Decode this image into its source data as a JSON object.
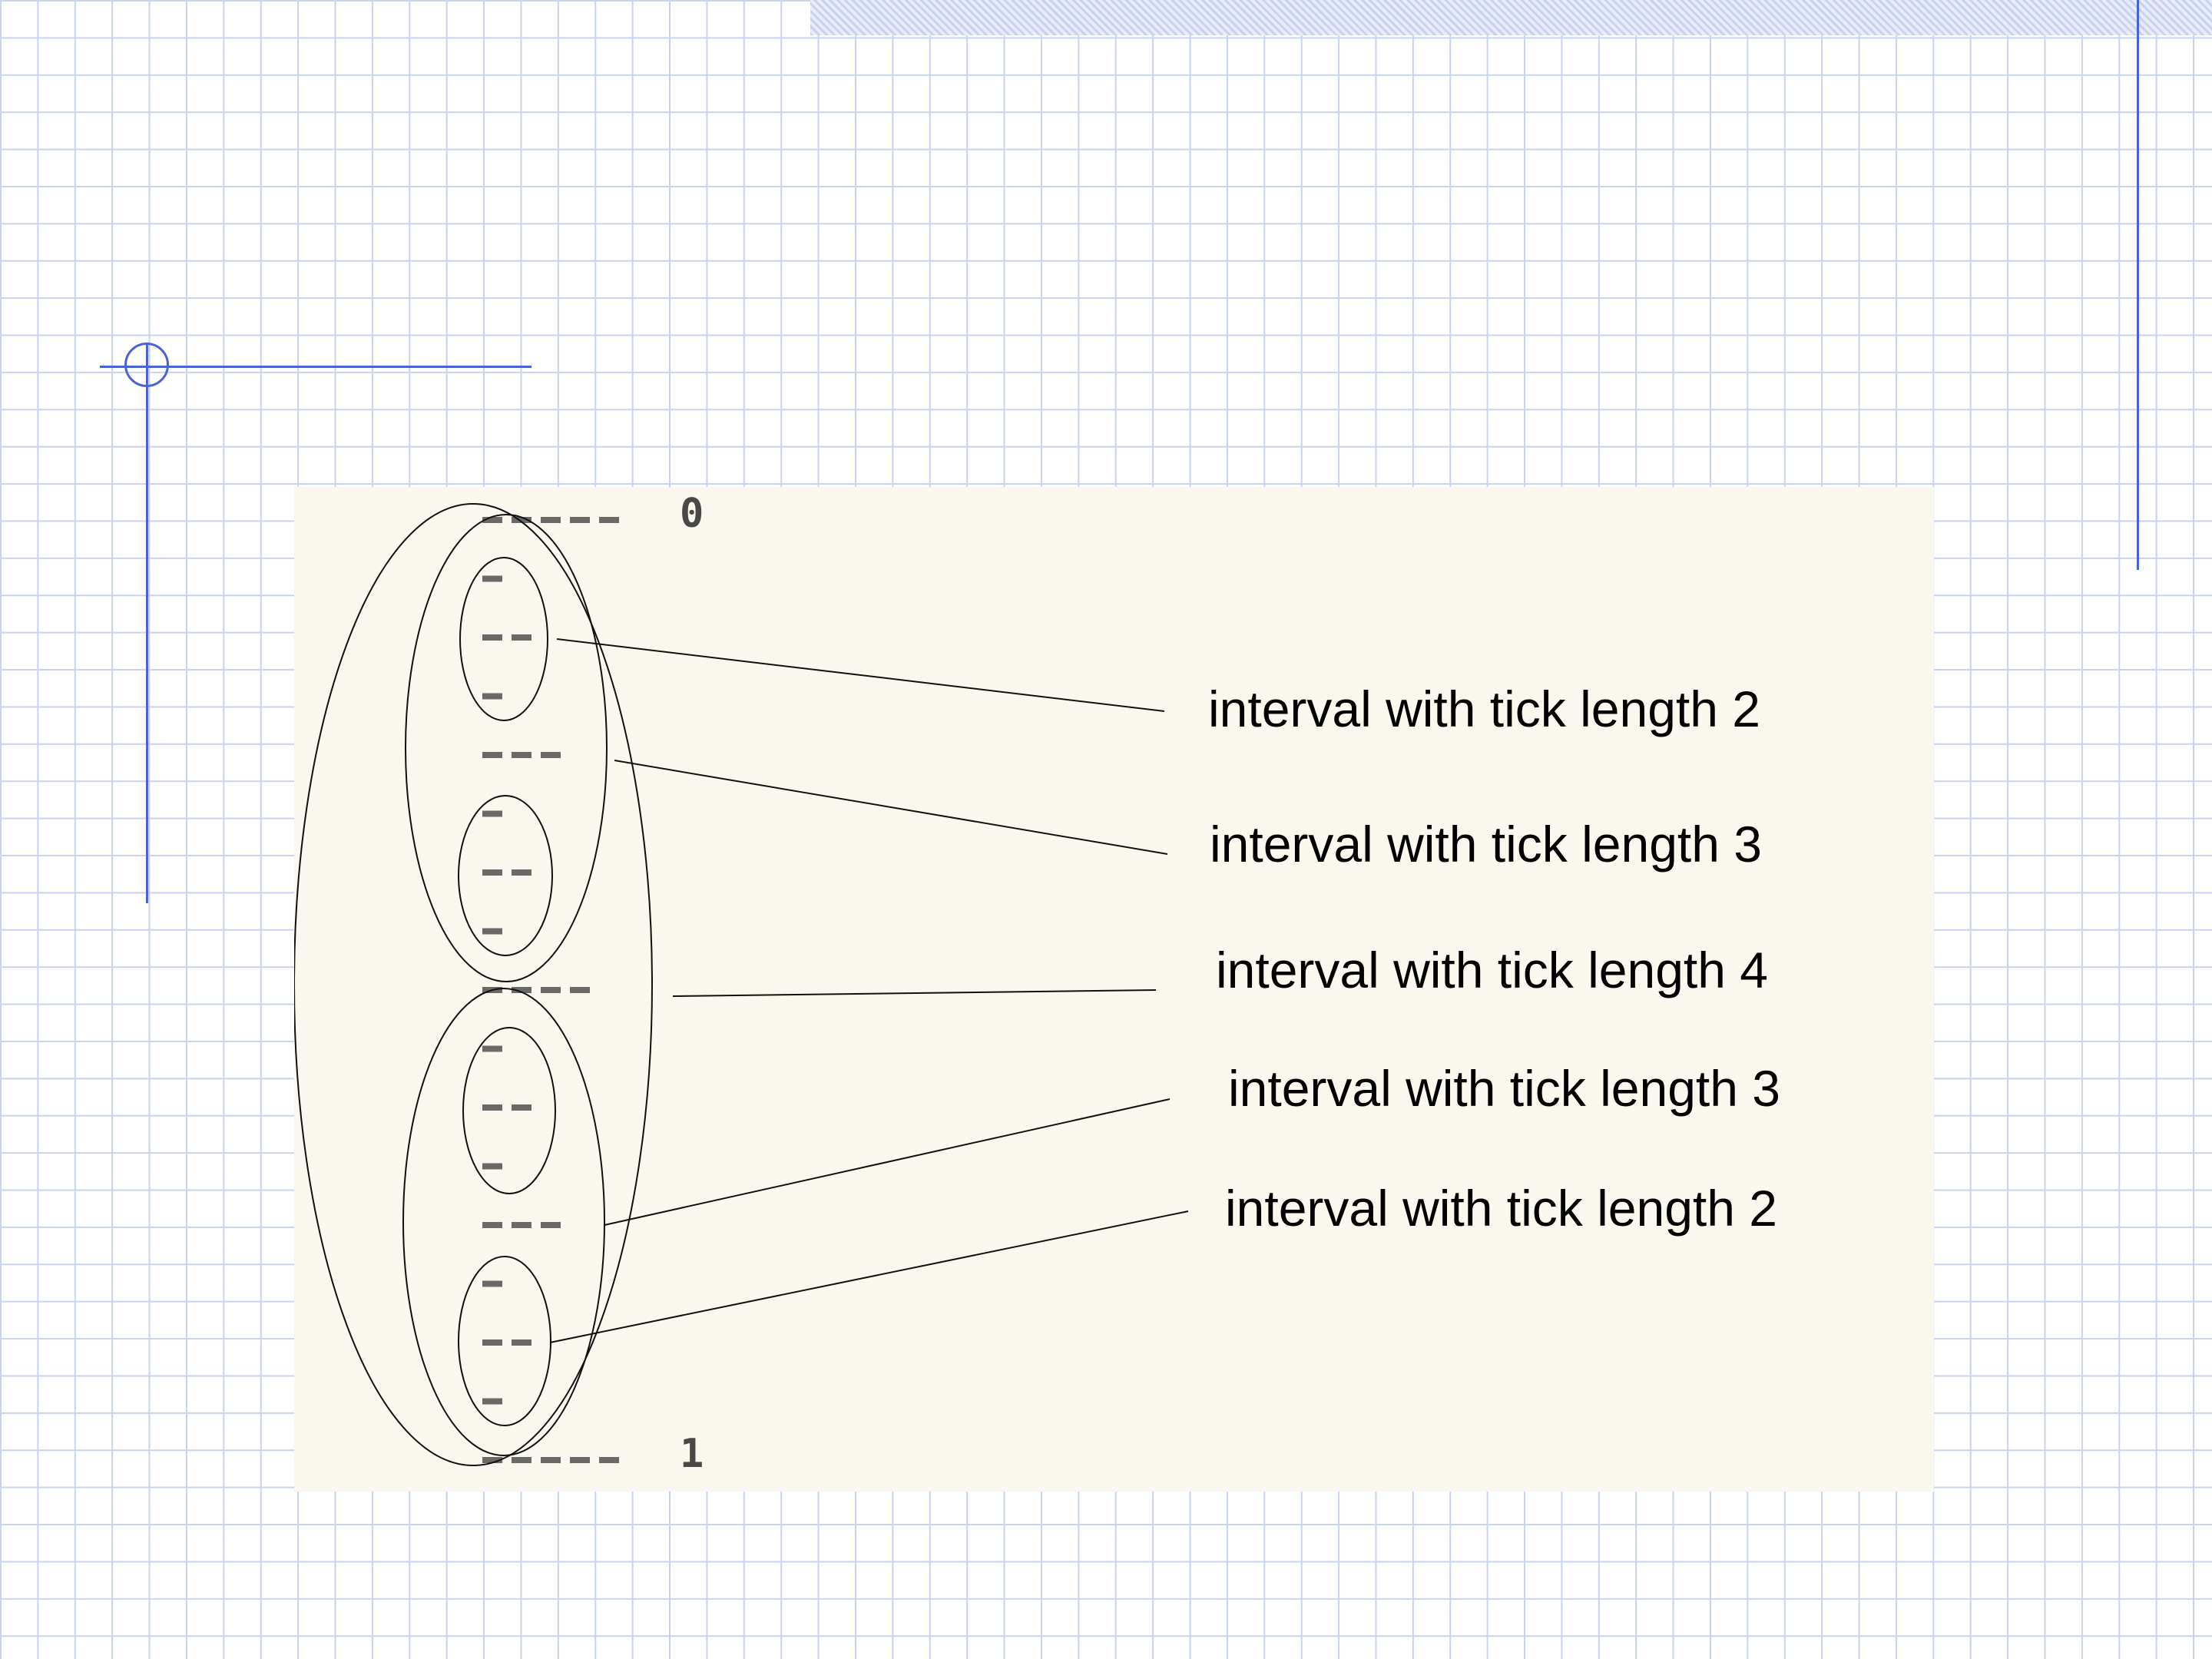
{
  "ruler": {
    "start_label": "0",
    "end_label": "1",
    "tick_lengths": [
      5,
      1,
      2,
      1,
      3,
      1,
      2,
      1,
      4,
      1,
      2,
      1,
      3,
      1,
      2,
      1,
      5
    ]
  },
  "callouts": [
    {
      "label": "interval with tick length 2"
    },
    {
      "label": "interval with tick length 3"
    },
    {
      "label": "interval with tick length 4"
    },
    {
      "label": "interval with tick length 3"
    },
    {
      "label": "interval with tick length 2"
    }
  ],
  "colors": {
    "panel_background": "#f9f7ee",
    "grid_line": "#c9d3ef",
    "accent_line": "#4a62d8"
  }
}
